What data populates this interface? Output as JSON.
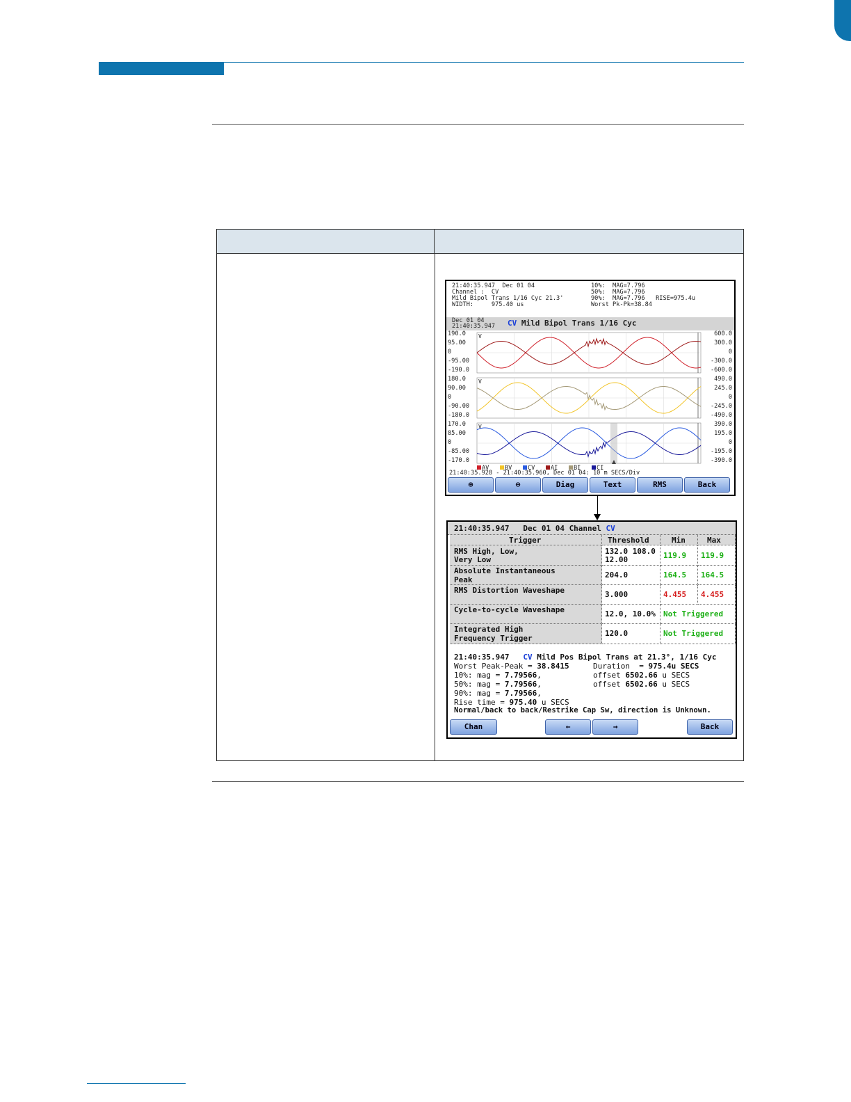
{
  "screen1": {
    "info_left": [
      "21:40:35.947  Dec 01 04",
      "Channel :  CV",
      "Mild Bipol Trans 1/16 Cyc 21.3'",
      "WIDTH:     975.40 us"
    ],
    "info_right": [
      "10%:  MAG=7.796",
      "50%:  MAG=7.796",
      "90%:  MAG=7.796   RISE=975.4u",
      "Worst Pk-Pk=38.84"
    ],
    "date_line1": "Dec 01 04",
    "date_line2": "21:40:35.947",
    "title_channel": "CV",
    "title_text": "Mild Bipol Trans 1/16 Cyc",
    "plots": [
      {
        "left_ticks": [
          "190.0",
          "95.00",
          "0",
          "-95.00",
          "-190.0"
        ],
        "right_ticks": [
          "600.0",
          "300.0",
          "0",
          "-300.0",
          "-600.0"
        ],
        "unit": "V",
        "colors": [
          "#d0202a",
          "#9e1a1a"
        ]
      },
      {
        "left_ticks": [
          "180.0",
          "90.00",
          "0",
          "-90.00",
          "-180.0"
        ],
        "right_ticks": [
          "490.0",
          "245.0",
          "0",
          "-245.0",
          "-490.0"
        ],
        "unit": "V",
        "colors": [
          "#f2c428",
          "#a59a78"
        ]
      },
      {
        "left_ticks": [
          "170.0",
          "85.00",
          "0",
          "-85.00",
          "-170.0"
        ],
        "right_ticks": [
          "390.0",
          "195.0",
          "0",
          "-195.0",
          "-390.0"
        ],
        "unit": "V",
        "colors": [
          "#2a5be0",
          "#1a1a9a"
        ]
      }
    ],
    "legend": [
      {
        "label": "AV",
        "color": "#d0202a"
      },
      {
        "label": "BV",
        "color": "#f2c428"
      },
      {
        "label": "CV",
        "color": "#2a5be0"
      },
      {
        "label": "AI",
        "color": "#9e1a1a"
      },
      {
        "label": "BI",
        "color": "#a59a78"
      },
      {
        "label": "CI",
        "color": "#1a1a9a"
      }
    ],
    "time_range": "21:40:35.928 - 21:40:35.960, Dec 01 04:   10 m SECS/Div",
    "buttons": [
      "⊕",
      "⊖",
      "Diag",
      "Text",
      "RMS",
      "Back"
    ]
  },
  "screen2": {
    "header_time": "21:40:35.947   Dec 01 04 Channel",
    "header_channel": "CV",
    "col_trigger": "Trigger",
    "col_threshold": "Threshold",
    "col_min": "Min",
    "col_max": "Max",
    "rows": [
      {
        "trigger1": "RMS High, Low,",
        "trigger2": "Very Low",
        "threshold1": "132.0 108.0",
        "threshold2": "12.00",
        "min": "119.9",
        "max": "119.9",
        "state": "green"
      },
      {
        "trigger1": "Absolute Instantaneous",
        "trigger2": "Peak",
        "threshold1": "204.0",
        "threshold2": "",
        "min": "164.5",
        "max": "164.5",
        "state": "green"
      },
      {
        "trigger1": "RMS Distortion Waveshape",
        "trigger2": "",
        "threshold1": "3.000",
        "threshold2": "",
        "min": "4.455",
        "max": "4.455",
        "state": "red"
      },
      {
        "trigger1": "Cycle-to-cycle Waveshape",
        "trigger2": "",
        "threshold1": "12.0, 10.0%",
        "threshold2": "",
        "status": "Not Triggered"
      },
      {
        "trigger1": "Integrated High",
        "trigger2": "Frequency Trigger",
        "threshold1": "120.0",
        "threshold2": "",
        "status": "Not Triggered"
      }
    ],
    "summary_time": "21:40:35.947",
    "summary_channel": "CV",
    "summary_title": "Mild Pos Bipol Trans at 21.3°, 1/16 Cyc",
    "worst_label": "Worst Peak-Peak = ",
    "worst_value": "38.8415",
    "duration_label": "Duration  = ",
    "duration_value": "975.4u SECS",
    "mag10_label": "10%: mag = ",
    "mag10_value": "7.79566",
    "mag50_label": "50%: mag = ",
    "mag50_value": "7.79566",
    "mag90_label": "90%: mag = ",
    "mag90_value": "7.79566",
    "offset_label": "offset ",
    "offset1_value": "6502.66",
    "offset2_value": "6502.66",
    "offset_unit": " u SECS",
    "rise_label": "Rise time = ",
    "rise_value": "975.40",
    "rise_unit": " u SECS",
    "conclusion": "Normal/back to back/Restrike Cap Sw, direction is Unknown.",
    "btn_chan": "Chan",
    "btn_prev": "←",
    "btn_next": "→",
    "btn_back": "Back"
  }
}
